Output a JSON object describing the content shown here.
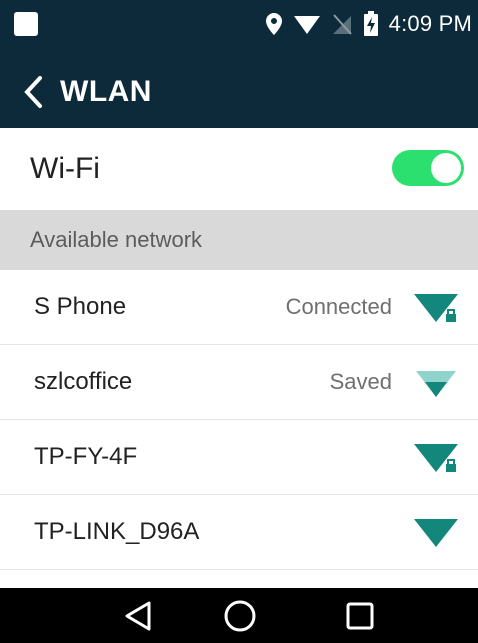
{
  "status_bar": {
    "time": "4:09 PM",
    "icons": [
      "notification-icon",
      "location-icon",
      "wifi-status-icon",
      "no-sim-icon",
      "battery-charging-icon"
    ]
  },
  "app_bar": {
    "title": "WLAN"
  },
  "wifi": {
    "label": "Wi-Fi",
    "enabled": true,
    "accent_color": "#2be06f"
  },
  "section": {
    "header": "Available network"
  },
  "networks": [
    {
      "name": "S Phone",
      "status": "Connected",
      "signal": "full",
      "locked": true
    },
    {
      "name": "szlcoffice",
      "status": "Saved",
      "signal": "medium",
      "locked": false
    },
    {
      "name": "TP-FY-4F",
      "status": "",
      "signal": "full",
      "locked": true
    },
    {
      "name": "TP-LINK_D96A",
      "status": "",
      "signal": "full",
      "locked": false
    }
  ],
  "colors": {
    "bar_bg": "#0c2a3a",
    "signal": "#13877b",
    "signal_faint": "#8fd3cc",
    "section_bg": "#d9d9d9"
  }
}
